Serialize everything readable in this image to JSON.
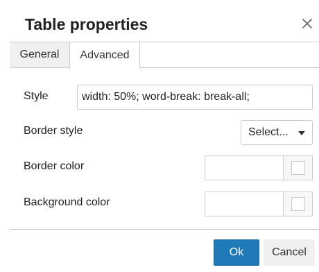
{
  "dialog": {
    "title": "Table properties",
    "close_icon": "close-icon"
  },
  "tabs": [
    {
      "label": "General",
      "active": false
    },
    {
      "label": "Advanced",
      "active": true
    }
  ],
  "form": {
    "style": {
      "label": "Style",
      "value": "width: 50%; word-break: break-all;"
    },
    "border_style": {
      "label": "Border style",
      "selected": "Select...",
      "icon": "caret-down-icon"
    },
    "border_color": {
      "label": "Border color",
      "value": "",
      "swatch_icon": "color-swatch-icon"
    },
    "background_color": {
      "label": "Background color",
      "value": "",
      "swatch_icon": "color-swatch-icon"
    }
  },
  "buttons": {
    "ok": "Ok",
    "cancel": "Cancel"
  },
  "colors": {
    "primary": "#207ab7",
    "border": "#cccccc",
    "tab_inactive_bg": "#f0f0f0"
  }
}
